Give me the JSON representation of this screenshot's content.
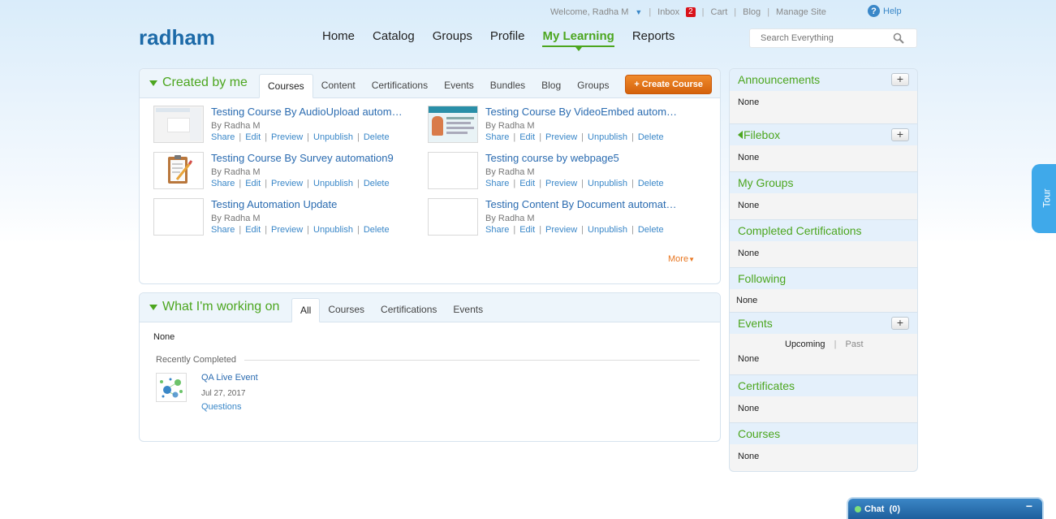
{
  "topbar": {
    "welcome": "Welcome, Radha M",
    "inbox_label": "Inbox",
    "inbox_count": "2",
    "cart": "Cart",
    "blog": "Blog",
    "manage_site": "Manage Site",
    "help": "Help"
  },
  "logo": "radham",
  "nav": [
    "Home",
    "Catalog",
    "Groups",
    "Profile",
    "My Learning",
    "Reports"
  ],
  "nav_active": "My Learning",
  "search": {
    "placeholder": "Search Everything"
  },
  "created": {
    "title": "Created by me",
    "tabs": [
      "Courses",
      "Content",
      "Certifications",
      "Events",
      "Bundles",
      "Blog",
      "Groups"
    ],
    "active_tab": "Courses",
    "create_button": "+ Create Course",
    "actions": [
      "Share",
      "Edit",
      "Preview",
      "Unpublish",
      "Delete"
    ],
    "items": [
      {
        "title": "Testing Course By AudioUpload autom…",
        "by": "By Radha M",
        "thumb": "screenshot-thumbnail"
      },
      {
        "title": "Testing Course By VideoEmbed autom…",
        "by": "By Radha M",
        "thumb": "video-tutorial-thumbnail"
      },
      {
        "title": "Testing Course By Survey automation9",
        "by": "By Radha M",
        "thumb": "survey-clipboard-icon"
      },
      {
        "title": "Testing course by webpage5",
        "by": "By Radha M",
        "thumb": "blank-thumbnail"
      },
      {
        "title": "Testing Automation Update",
        "by": "By Radha M",
        "thumb": "blank-thumbnail"
      },
      {
        "title": "Testing Content By Document automat…",
        "by": "By Radha M",
        "thumb": "blank-thumbnail"
      }
    ],
    "more": "More"
  },
  "working": {
    "title": "What I'm working on",
    "tabs": [
      "All",
      "Courses",
      "Certifications",
      "Events"
    ],
    "active_tab": "All",
    "none": "None",
    "recently_completed": "Recently Completed",
    "completed_item": {
      "title": "QA Live Event",
      "date": "Jul 27, 2017",
      "link": "Questions"
    }
  },
  "sidebar": {
    "announcements": {
      "title": "Announcements",
      "body": "None"
    },
    "filebox": {
      "title": "Filebox",
      "body": "None"
    },
    "my_groups": {
      "title": "My Groups",
      "body": "None"
    },
    "completed_certifications": {
      "title": "Completed Certifications",
      "body": "None"
    },
    "following": {
      "title": "Following",
      "body": "None"
    },
    "events": {
      "title": "Events",
      "upcoming": "Upcoming",
      "past": "Past",
      "body": "None"
    },
    "certificates": {
      "title": "Certificates",
      "body": "None"
    },
    "courses": {
      "title": "Courses",
      "body": "None"
    }
  },
  "tour": "Tour",
  "chat": {
    "label": "Chat",
    "count": "(0)"
  },
  "colors": {
    "accent_green": "#4ca61f",
    "link_blue": "#3a87c8",
    "orange": "#e87722",
    "logo_blue": "#1c6aa8"
  }
}
